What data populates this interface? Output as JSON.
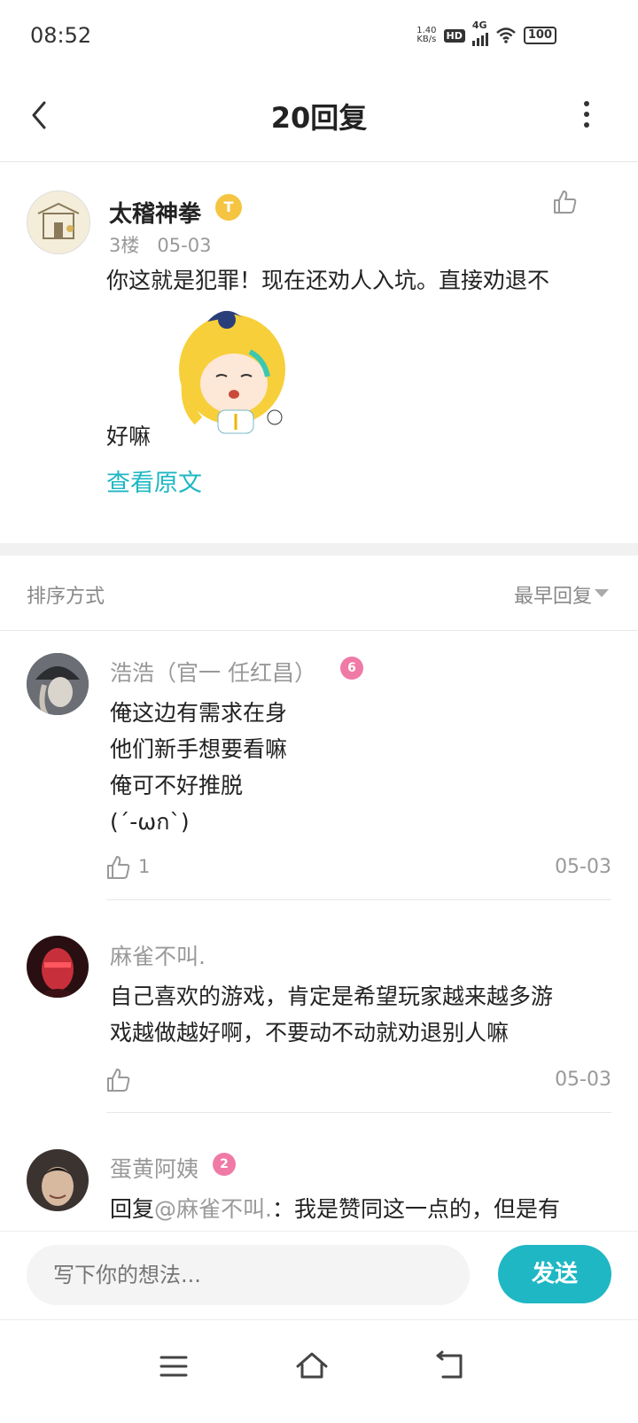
{
  "status_bar": {
    "time": "08:52",
    "net_speed_value": "1.40",
    "net_speed_unit": "KB/s",
    "hd": "HD",
    "network": "4G",
    "battery": "100"
  },
  "header": {
    "title": "20回复",
    "back_icon": "chevron-left-icon",
    "more_icon": "more-vertical-icon"
  },
  "post": {
    "author": "太稽神拳",
    "badge": "T",
    "floor": "3楼",
    "date": "05-03",
    "text_line1": "你这就是犯罪！现在还劝人入坑。直接劝退不",
    "text_line2": "好嘛",
    "view_original": "查看原文"
  },
  "sort": {
    "label": "排序方式",
    "value": "最早回复"
  },
  "replies": [
    {
      "name": "浩浩（官一 任红昌）",
      "badge": "6",
      "text": "俺这边有需求在身\n他们新手想要看嘛\n俺可不好推脱\n(´-ωก`)",
      "likes": "1",
      "date": "05-03"
    },
    {
      "name": "麻雀不叫.",
      "text": "自己喜欢的游戏，肯定是希望玩家越来越多游\n戏越做越好啊，不要动不动就劝退别人嘛",
      "date": "05-03"
    },
    {
      "name": "蛋黄阿姨",
      "badge": "2",
      "text_prefix": "回复",
      "mention": "@麻雀不叫.",
      "text": "：我是赞同这一点的，但是有"
    }
  ],
  "input": {
    "placeholder": "写下你的想法...",
    "send_label": "发送"
  },
  "colors": {
    "accent": "#1fb7c4",
    "badge_gold": "#f5c542",
    "badge_pink": "#f07aa6"
  }
}
